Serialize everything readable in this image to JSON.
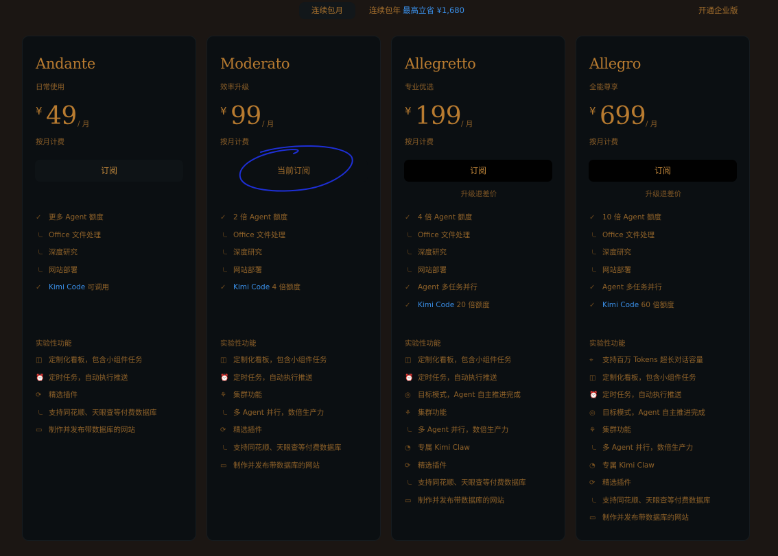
{
  "topbar": {
    "monthly": "连续包月",
    "yearly": "连续包年",
    "yearly_save": "最高立省 ¥1,680",
    "enterprise": "开通企业版"
  },
  "colors": {
    "accent": "#b87b30",
    "link": "#3a8fe8",
    "card_bg": "#0b0f12",
    "page_bg": "#1b1613",
    "annotation": "#1e2fd6"
  },
  "plans": [
    {
      "name": "Andante",
      "subtitle": "日常使用",
      "currency": "¥",
      "price": "49",
      "per": "/ 月",
      "billing": "按月计费",
      "cta": "订阅",
      "note": "",
      "features": [
        {
          "icon": "check",
          "text": "更多 Agent 额度"
        },
        {
          "icon": "sub",
          "text": "Office 文件处理"
        },
        {
          "icon": "sub",
          "text": "深度研究"
        },
        {
          "icon": "sub",
          "text": "网站部署"
        },
        {
          "icon": "check",
          "link": "Kimi Code",
          "text": " 可调用"
        }
      ],
      "exp_title": "实验性功能",
      "experimental": [
        {
          "icon": "dashboard",
          "text": "定制化看板，包含小组件任务"
        },
        {
          "icon": "alarm",
          "text": "定时任务，自动执行推送"
        },
        {
          "icon": "plugin",
          "text": "精选插件"
        },
        {
          "icon": "sub",
          "text": "支持同花顺、天眼查等付费数据库"
        },
        {
          "icon": "browser",
          "text": "制作并发布带数据库的网站"
        }
      ]
    },
    {
      "name": "Moderato",
      "subtitle": "效率升级",
      "currency": "¥",
      "price": "99",
      "per": "/ 月",
      "billing": "按月计费",
      "cta": "当前订阅",
      "note": "",
      "features": [
        {
          "icon": "check",
          "text": "2 倍 Agent 额度"
        },
        {
          "icon": "sub",
          "text": "Office 文件处理"
        },
        {
          "icon": "sub",
          "text": "深度研究"
        },
        {
          "icon": "sub",
          "text": "网站部署"
        },
        {
          "icon": "check",
          "link": "Kimi Code",
          "text": " 4 倍额度"
        }
      ],
      "exp_title": "实验性功能",
      "experimental": [
        {
          "icon": "dashboard",
          "text": "定制化看板，包含小组件任务"
        },
        {
          "icon": "alarm",
          "text": "定时任务，自动执行推送"
        },
        {
          "icon": "cluster",
          "text": "集群功能"
        },
        {
          "icon": "sub",
          "text": "多 Agent 并行，数倍生产力"
        },
        {
          "icon": "plugin",
          "text": "精选插件"
        },
        {
          "icon": "sub",
          "text": "支持同花顺、天眼查等付费数据库"
        },
        {
          "icon": "browser",
          "text": "制作并发布带数据库的网站"
        }
      ]
    },
    {
      "name": "Allegretto",
      "subtitle": "专业优选",
      "currency": "¥",
      "price": "199",
      "per": "/ 月",
      "billing": "按月计费",
      "cta": "订阅",
      "note": "升级退差价",
      "features": [
        {
          "icon": "check",
          "text": "4 倍 Agent 额度"
        },
        {
          "icon": "sub",
          "text": "Office 文件处理"
        },
        {
          "icon": "sub",
          "text": "深度研究"
        },
        {
          "icon": "sub",
          "text": "网站部署"
        },
        {
          "icon": "check",
          "text": "Agent 多任务并行"
        },
        {
          "icon": "check",
          "link": "Kimi Code",
          "text": " 20 倍额度"
        }
      ],
      "exp_title": "实验性功能",
      "experimental": [
        {
          "icon": "dashboard",
          "text": "定制化看板，包含小组件任务"
        },
        {
          "icon": "alarm",
          "text": "定时任务，自动执行推送"
        },
        {
          "icon": "target",
          "text": "目标模式，Agent 自主推进完成"
        },
        {
          "icon": "cluster",
          "text": "集群功能"
        },
        {
          "icon": "sub",
          "text": "多 Agent 并行，数倍生产力"
        },
        {
          "icon": "claw",
          "text": "专属 Kimi Claw"
        },
        {
          "icon": "plugin",
          "text": "精选插件"
        },
        {
          "icon": "sub",
          "text": "支持同花顺、天眼查等付费数据库"
        },
        {
          "icon": "browser",
          "text": "制作并发布带数据库的网站"
        }
      ]
    },
    {
      "name": "Allegro",
      "subtitle": "全能尊享",
      "currency": "¥",
      "price": "699",
      "per": "/ 月",
      "billing": "按月计费",
      "cta": "订阅",
      "note": "升级退差价",
      "features": [
        {
          "icon": "check",
          "text": "10 倍 Agent 额度"
        },
        {
          "icon": "sub",
          "text": "Office 文件处理"
        },
        {
          "icon": "sub",
          "text": "深度研究"
        },
        {
          "icon": "sub",
          "text": "网站部署"
        },
        {
          "icon": "check",
          "text": "Agent 多任务并行"
        },
        {
          "icon": "check",
          "link": "Kimi Code",
          "text": " 60 倍额度"
        }
      ],
      "exp_title": "实验性功能",
      "experimental": [
        {
          "icon": "pin",
          "text": "支持百万 Tokens 超长对话容量"
        },
        {
          "icon": "dashboard",
          "text": "定制化看板，包含小组件任务"
        },
        {
          "icon": "alarm",
          "text": "定时任务，自动执行推送"
        },
        {
          "icon": "target",
          "text": "目标模式，Agent 自主推进完成"
        },
        {
          "icon": "cluster",
          "text": "集群功能"
        },
        {
          "icon": "sub",
          "text": "多 Agent 并行，数倍生产力"
        },
        {
          "icon": "claw",
          "text": "专属 Kimi Claw"
        },
        {
          "icon": "plugin",
          "text": "精选插件"
        },
        {
          "icon": "sub",
          "text": "支持同花顺、天眼查等付费数据库"
        },
        {
          "icon": "browser",
          "text": "制作并发布带数据库的网站"
        }
      ]
    }
  ]
}
